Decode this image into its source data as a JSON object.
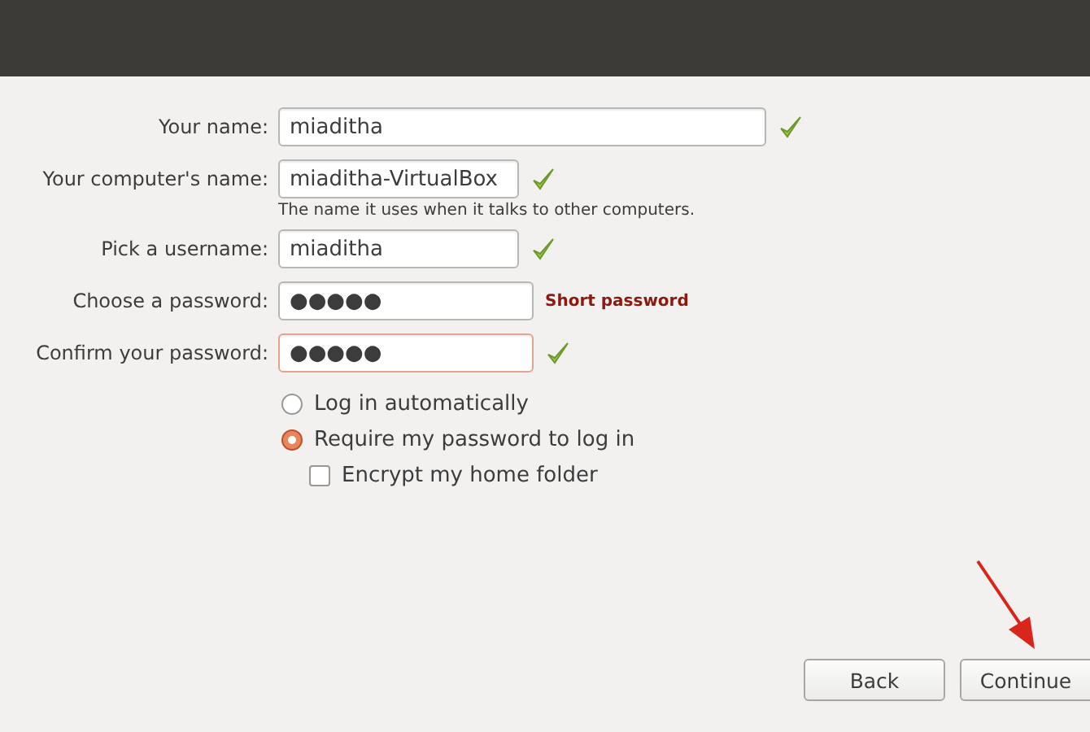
{
  "fields": [
    {
      "label": "Your name:",
      "value": "miaditha",
      "valid": true,
      "focused": false
    },
    {
      "label": "Your computer's name:",
      "value": "miaditha-VirtualBox",
      "valid": true,
      "focused": false,
      "hint": "The name it uses when it talks to other computers."
    },
    {
      "label": "Pick a username:",
      "value": "miaditha",
      "valid": true,
      "focused": false
    },
    {
      "label": "Choose a password:",
      "value": "●●●●●",
      "valid": false,
      "focused": false,
      "message": "Short password"
    },
    {
      "label": "Confirm your password:",
      "value": "●●●●●",
      "valid": true,
      "focused": true
    }
  ],
  "login_options": [
    {
      "label": "Log in automatically",
      "selected": false
    },
    {
      "label": "Require my password to log in",
      "selected": true
    }
  ],
  "encrypt": {
    "label": "Encrypt my home folder",
    "checked": false
  },
  "buttons": [
    {
      "label": "Back"
    },
    {
      "label": "Continue"
    }
  ]
}
